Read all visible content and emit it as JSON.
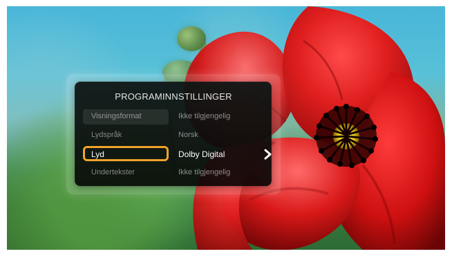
{
  "menu": {
    "title": "PROGRAMINNSTILLINGER",
    "rows": [
      {
        "label": "Visningsformat",
        "value": "Ikke tilgjengelig"
      },
      {
        "label": "Lydspråk",
        "value": "Norsk"
      },
      {
        "label": "Lyd",
        "value": "Dolby Digital",
        "icon": "chevron-right-icon"
      },
      {
        "label": "Undertekster",
        "value": "Ikke tilgjengelig"
      }
    ]
  },
  "colors": {
    "focus": "#f0a32c",
    "flower": "#d31616",
    "flower_dark": "#7b0707",
    "flower_center": "#ffe93a"
  }
}
